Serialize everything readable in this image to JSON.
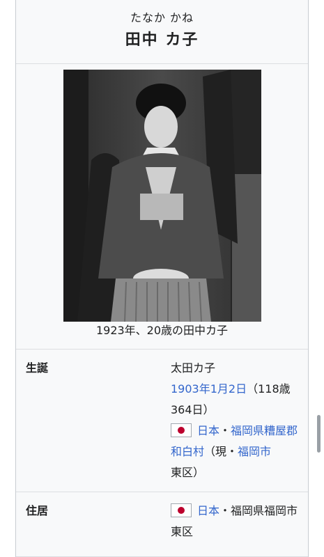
{
  "infobox": {
    "ruby": "たなか かね",
    "name": "田中 カ子",
    "caption": "1923年、20歳の田中カ子",
    "birth": {
      "label": "生誕",
      "line1": "太田カ子",
      "date_link": "1903年1月2日",
      "age": "（118歳364日）",
      "country_link": "日本",
      "sep1": "・",
      "pref_link": "福岡県糟屋郡和白村",
      "now_open": "（現・",
      "city_link": "福岡市",
      "ward_close": "東区）"
    },
    "residence": {
      "label": "住居",
      "country_link": "日本",
      "rest": "・福岡県福岡市東区"
    }
  },
  "colors": {
    "link": "#3366cc",
    "flag_red": "#bc002d",
    "infobox_bg": "#f8f9fa"
  }
}
